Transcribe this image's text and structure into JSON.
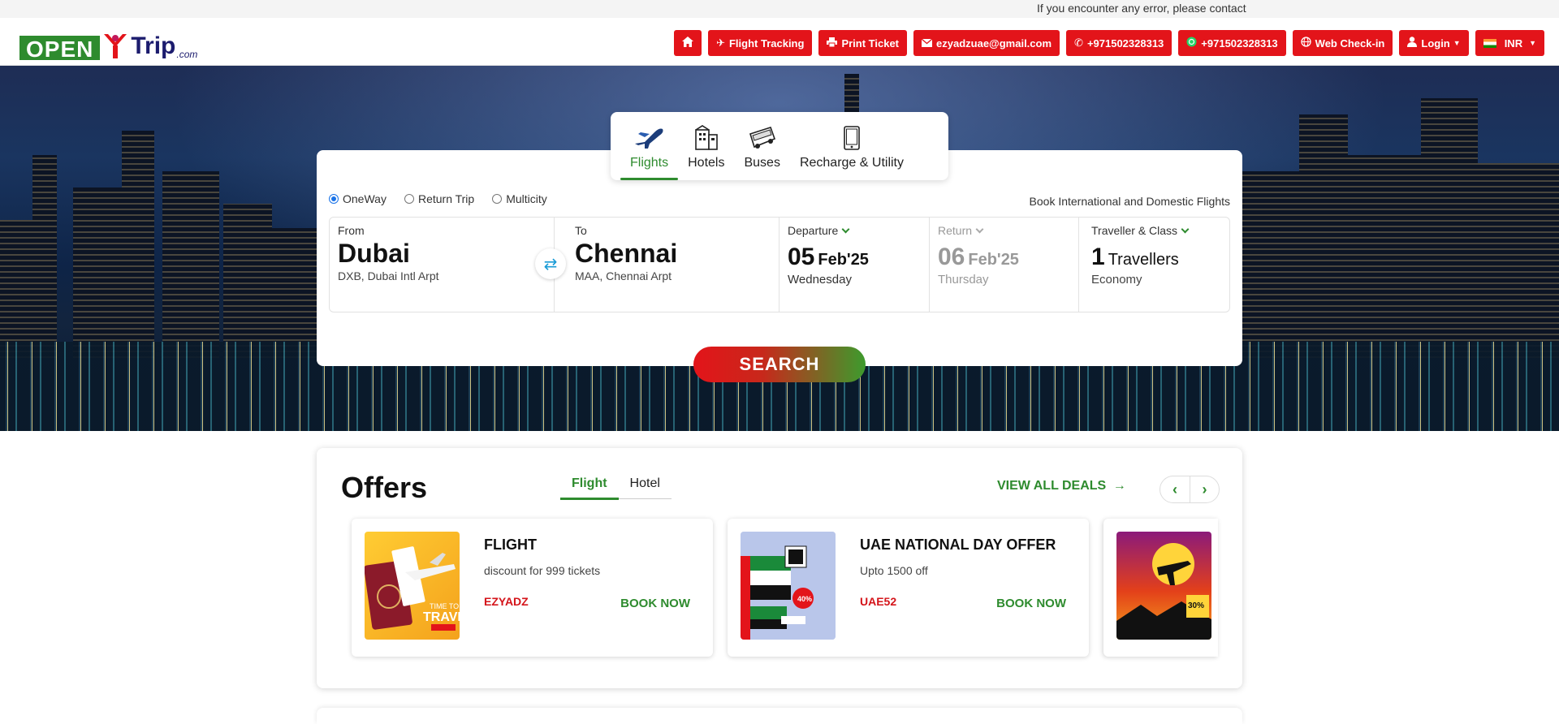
{
  "top_message": "If you encounter any error, please contact",
  "logo": {
    "part1": "OPEN",
    "part2": "Trip",
    "part3": ".com"
  },
  "nav": {
    "flight_tracking": "Flight Tracking",
    "print_ticket": "Print Ticket",
    "email": "ezyadzuae@gmail.com",
    "phone": "+971502328313",
    "whatsapp": "+971502328313",
    "web_checkin": "Web Check-in",
    "login": "Login",
    "currency": "INR"
  },
  "tabs": [
    {
      "label": "Flights",
      "icon": "airplane-icon"
    },
    {
      "label": "Hotels",
      "icon": "hotel-icon"
    },
    {
      "label": "Buses",
      "icon": "bus-icon"
    },
    {
      "label": "Recharge & Utility",
      "icon": "mobile-icon"
    }
  ],
  "trip_types": [
    "OneWay",
    "Return Trip",
    "Multicity"
  ],
  "selected_trip_type": "OneWay",
  "card_note": "Book International and Domestic Flights",
  "search": {
    "from_label": "From",
    "from_city": "Dubai",
    "from_airport": "DXB, Dubai Intl Arpt",
    "to_label": "To",
    "to_city": "Chennai",
    "to_airport": "MAA, Chennai Arpt",
    "departure_label": "Departure",
    "departure_day": "05",
    "departure_month": "Feb'25",
    "departure_weekday": "Wednesday",
    "return_label": "Return",
    "return_day": "06",
    "return_month": "Feb'25",
    "return_weekday": "Thursday",
    "traveller_label": "Traveller & Class",
    "traveller_count": "1",
    "traveller_word": "Travellers",
    "traveller_class": "Economy",
    "button": "SEARCH"
  },
  "offers": {
    "title": "Offers",
    "tabs": [
      "Flight",
      "Hotel"
    ],
    "view_all": "VIEW ALL DEALS",
    "items": [
      {
        "title": "FLIGHT",
        "desc": "discount for 999 tickets",
        "code": "EZYADZ",
        "cta": "BOOK NOW"
      },
      {
        "title": "UAE NATIONAL DAY OFFER",
        "desc": "Upto 1500 off",
        "code": "UAE52",
        "cta": "BOOK NOW"
      }
    ]
  },
  "colors": {
    "brand_red": "#e3141a",
    "brand_green": "#2e8b2e",
    "navy": "#1c1c6e"
  }
}
